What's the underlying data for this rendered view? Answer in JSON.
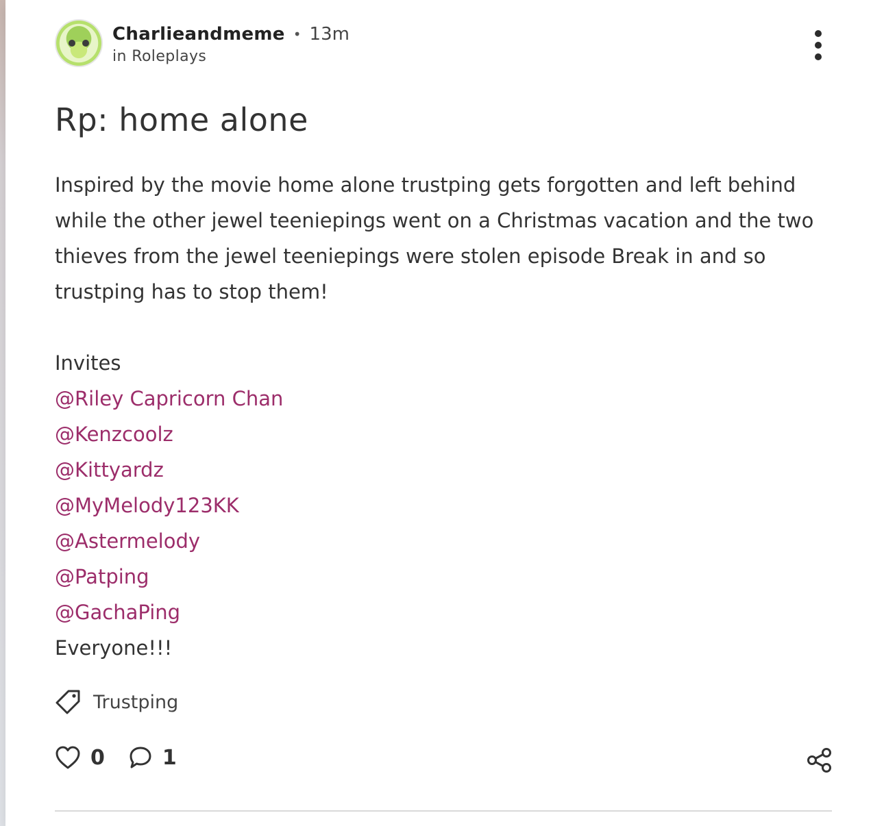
{
  "post": {
    "author": "Charlieandmeme",
    "time": "13m",
    "community": "in Roleplays",
    "title": "Rp: home alone",
    "body": "Inspired by the movie home alone trustping gets forgotten and left behind while the other jewel teeniepings went on a Christmas vacation and the two thieves from the jewel teeniepings were stolen episode Break in and so trustping has to stop them!",
    "invites_heading": "Invites",
    "mentions": [
      "@Riley Capricorn Chan",
      "@Kenzcoolz",
      "@Kittyardz",
      "@MyMelody123KK",
      "@Astermelody",
      "@Patping",
      "@GachaPing"
    ],
    "closing": "Everyone!!!",
    "tag": "Trustping",
    "likes": "0",
    "comments": "1"
  },
  "colors": {
    "mention": "#9c2d6a",
    "text": "#333333"
  },
  "icons": [
    "more-vertical-icon",
    "tag-icon",
    "heart-icon",
    "comment-icon",
    "share-icon"
  ]
}
